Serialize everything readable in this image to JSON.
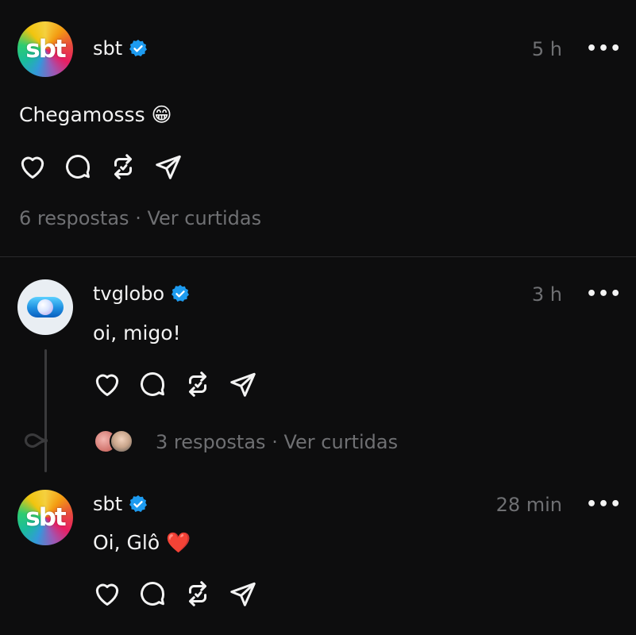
{
  "posts": [
    {
      "username": "sbt",
      "avatar_text": "sbt",
      "time": "5 h",
      "text": "Chegamosss",
      "emoji": "😁",
      "meta": {
        "replies": "6 respostas",
        "separator": "·",
        "likes": "Ver curtidas"
      }
    },
    {
      "username": "tvglobo",
      "time": "3 h",
      "text": "oi, migo!",
      "meta": {
        "replies": "3 respostas",
        "separator": "·",
        "likes": "Ver curtidas"
      }
    },
    {
      "username": "sbt",
      "avatar_text": "sbt",
      "time": "28 min",
      "text": "Oi, Glô",
      "emoji": "❤️"
    }
  ],
  "more_label": "•••",
  "colors": {
    "background": "#0d0d0e",
    "muted": "#6f7073",
    "verified": "#1d9bf0",
    "text": "#f3f3f3"
  },
  "icons": [
    "heart-icon",
    "comment-icon",
    "repost-icon",
    "share-icon",
    "verified-icon",
    "more-icon"
  ]
}
